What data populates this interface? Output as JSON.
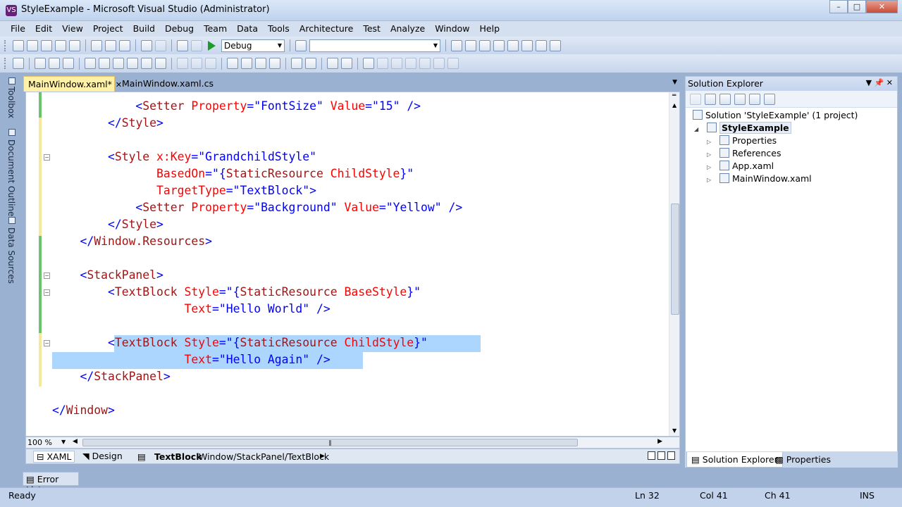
{
  "window": {
    "title": "StyleExample - Microsoft Visual Studio (Administrator)",
    "app_icon": "VS"
  },
  "menu": [
    "File",
    "Edit",
    "View",
    "Project",
    "Build",
    "Debug",
    "Team",
    "Data",
    "Tools",
    "Architecture",
    "Test",
    "Analyze",
    "Window",
    "Help"
  ],
  "toolbar": {
    "config": "Debug",
    "platform": ""
  },
  "left_strip": {
    "toolbox": "Toolbox",
    "document_outline": "Document Outline",
    "data_sources": "Data Sources"
  },
  "tabs": {
    "active": "MainWindow.xaml*",
    "inactive": "MainWindow.xaml.cs"
  },
  "code_lines": [
    {
      "indent": "            ",
      "tokens": [
        [
          "kw-blue",
          "<"
        ],
        [
          "kw-dark",
          "Setter"
        ],
        [
          "kw-red",
          " Property"
        ],
        [
          "kw-blue",
          "=\"FontSize\""
        ],
        [
          "kw-red",
          " Value"
        ],
        [
          "kw-blue",
          "=\"15\" />"
        ]
      ]
    },
    {
      "indent": "        ",
      "tokens": [
        [
          "kw-blue",
          "</"
        ],
        [
          "kw-dark",
          "Style"
        ],
        [
          "kw-blue",
          ">"
        ]
      ]
    },
    {
      "indent": "",
      "tokens": []
    },
    {
      "indent": "        ",
      "tokens": [
        [
          "kw-blue",
          "<"
        ],
        [
          "kw-dark",
          "Style"
        ],
        [
          "kw-red",
          " x:Key"
        ],
        [
          "kw-blue",
          "=\"GrandchildStyle\""
        ]
      ]
    },
    {
      "indent": "               ",
      "tokens": [
        [
          "kw-red",
          "BasedOn"
        ],
        [
          "kw-blue",
          "=\"{"
        ],
        [
          "kw-dark",
          "StaticResource"
        ],
        [
          "kw-red",
          " ChildStyle"
        ],
        [
          "kw-blue",
          "}\""
        ]
      ]
    },
    {
      "indent": "               ",
      "tokens": [
        [
          "kw-red",
          "TargetType"
        ],
        [
          "kw-blue",
          "=\"TextBlock\">"
        ]
      ]
    },
    {
      "indent": "            ",
      "tokens": [
        [
          "kw-blue",
          "<"
        ],
        [
          "kw-dark",
          "Setter"
        ],
        [
          "kw-red",
          " Property"
        ],
        [
          "kw-blue",
          "=\"Background\""
        ],
        [
          "kw-red",
          " Value"
        ],
        [
          "kw-blue",
          "=\"Yellow\" />"
        ]
      ]
    },
    {
      "indent": "        ",
      "tokens": [
        [
          "kw-blue",
          "</"
        ],
        [
          "kw-dark",
          "Style"
        ],
        [
          "kw-blue",
          ">"
        ]
      ]
    },
    {
      "indent": "    ",
      "tokens": [
        [
          "kw-blue",
          "</"
        ],
        [
          "kw-dark",
          "Window.Resources"
        ],
        [
          "kw-blue",
          ">"
        ]
      ]
    },
    {
      "indent": "",
      "tokens": []
    },
    {
      "indent": "    ",
      "tokens": [
        [
          "kw-blue",
          "<"
        ],
        [
          "kw-dark",
          "StackPanel"
        ],
        [
          "kw-blue",
          ">"
        ]
      ]
    },
    {
      "indent": "        ",
      "tokens": [
        [
          "kw-blue",
          "<"
        ],
        [
          "kw-dark",
          "TextBlock"
        ],
        [
          "kw-red",
          " Style"
        ],
        [
          "kw-blue",
          "=\"{"
        ],
        [
          "kw-dark",
          "StaticResource"
        ],
        [
          "kw-red",
          " BaseStyle"
        ],
        [
          "kw-blue",
          "}\""
        ]
      ]
    },
    {
      "indent": "                   ",
      "tokens": [
        [
          "kw-red",
          "Text"
        ],
        [
          "kw-blue",
          "=\"Hello World\" />"
        ]
      ]
    },
    {
      "indent": "",
      "tokens": []
    },
    {
      "indent": "        ",
      "tokens": [
        [
          "kw-blue",
          "<"
        ],
        [
          "kw-dark",
          "TextBlock"
        ],
        [
          "kw-red",
          " Style"
        ],
        [
          "kw-blue",
          "=\"{"
        ],
        [
          "kw-dark",
          "StaticResource"
        ],
        [
          "kw-red",
          " ChildStyle"
        ],
        [
          "kw-blue",
          "}\""
        ]
      ]
    },
    {
      "indent": "                   ",
      "tokens": [
        [
          "kw-red",
          "Text"
        ],
        [
          "kw-blue",
          "=\"Hello Again\" />"
        ]
      ]
    },
    {
      "indent": "    ",
      "tokens": [
        [
          "kw-blue",
          "</"
        ],
        [
          "kw-dark",
          "StackPanel"
        ],
        [
          "kw-blue",
          ">"
        ]
      ]
    },
    {
      "indent": "",
      "tokens": []
    },
    {
      "indent": "",
      "tokens": [
        [
          "kw-blue",
          "</"
        ],
        [
          "kw-dark",
          "Window"
        ],
        [
          "kw-blue",
          ">"
        ]
      ]
    }
  ],
  "editor": {
    "zoom": "100 %"
  },
  "designbar": {
    "xaml": "XAML",
    "design": "Design",
    "element": "TextBlock",
    "path": "Window/StackPanel/TextBlock"
  },
  "solution_explorer": {
    "title": "Solution Explorer",
    "solution": "Solution 'StyleExample' (1 project)",
    "project": "StyleExample",
    "items": [
      "Properties",
      "References",
      "App.xaml",
      "MainWindow.xaml"
    ]
  },
  "right_tabs": {
    "solution_explorer": "Solution Explorer",
    "properties": "Properties"
  },
  "error_list": "Error List",
  "status": {
    "ready": "Ready",
    "ln": "Ln 32",
    "col": "Col 41",
    "ch": "Ch 41",
    "ins": "INS"
  }
}
